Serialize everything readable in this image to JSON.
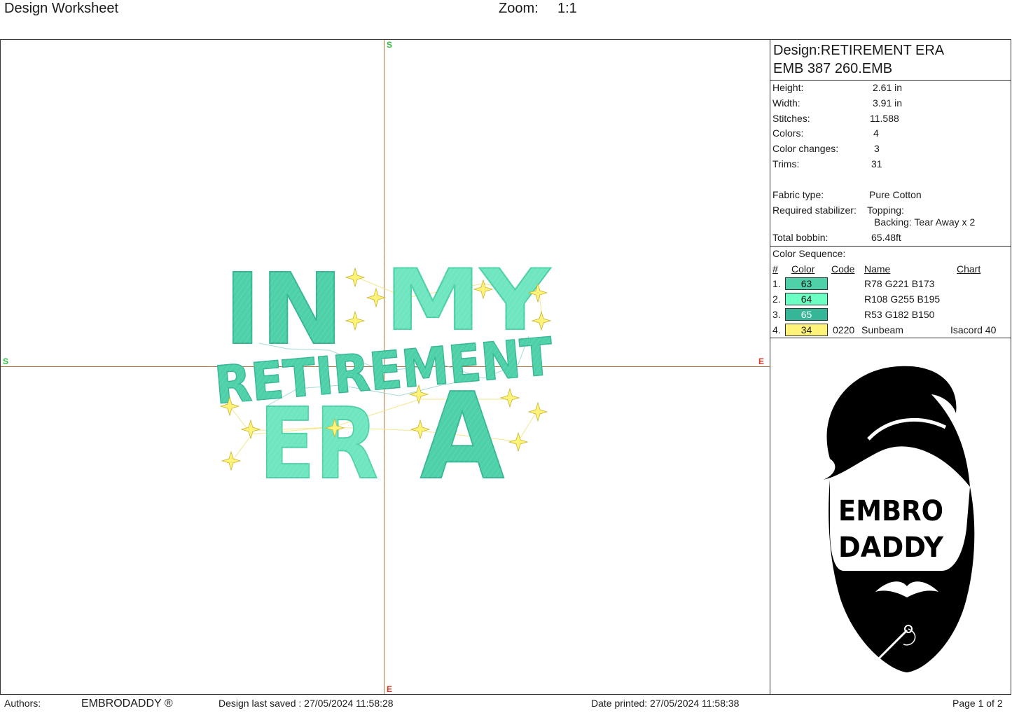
{
  "header": {
    "title": "Design Worksheet",
    "zoom_label": "Zoom:",
    "zoom_value": "1:1"
  },
  "canvas": {
    "markers": {
      "top": "S",
      "left": "S",
      "right": "E",
      "bottom": "E"
    },
    "design_text": {
      "line1": "IN MY",
      "line2": "RETIREMENT",
      "line3": "ERA"
    },
    "colors": {
      "teal_dark": "#4ad2a8",
      "teal_light": "#6fe6c0",
      "teal_mid": "#35b696",
      "star": "#fff37a",
      "guide": "#b5733c"
    }
  },
  "info": {
    "design_name": "Design:RETIREMENT ERA",
    "file_name": "EMB 387 260.EMB",
    "properties": [
      {
        "label": "Height:",
        "value": "2.61 in"
      },
      {
        "label": "Width:",
        "value": "3.91 in"
      },
      {
        "label": "Stitches:",
        "value": "11.588"
      },
      {
        "label": "Colors:",
        "value": "4"
      },
      {
        "label": "Color changes:",
        "value": "3"
      },
      {
        "label": "Trims:",
        "value": "31"
      }
    ],
    "fabric": {
      "label": "Fabric type:",
      "value": "Pure Cotton"
    },
    "stabilizer": {
      "label": "Required stabilizer:",
      "topping": "Topping:",
      "backing": "Backing: Tear Away x 2"
    },
    "bobbin": {
      "label": "Total bobbin:",
      "value": "65.48ft"
    },
    "sequence": {
      "title": "Color Sequence:",
      "headers": {
        "num": "#",
        "color": "Color",
        "code": "Code",
        "name": "Name",
        "chart": "Chart"
      },
      "rows": [
        {
          "num": "1.",
          "swatch": "63",
          "hex": "#4ed1a8",
          "code": "",
          "name": "R78 G221 B173",
          "chart": ""
        },
        {
          "num": "2.",
          "swatch": "64",
          "hex": "#6cffc3",
          "code": "",
          "name": "R108 G255 B195",
          "chart": ""
        },
        {
          "num": "3.",
          "swatch": "65",
          "hex": "#35b696",
          "code": "",
          "name": "R53 G182 B150",
          "chart": ""
        },
        {
          "num": "4.",
          "swatch": "34",
          "hex": "#fff37a",
          "code": "0220",
          "name": "Sunbeam",
          "chart": "Isacord 40"
        }
      ]
    },
    "logo": {
      "line1": "EMBRO",
      "line2": "DADDY"
    }
  },
  "footer": {
    "authors_label": "Authors:",
    "authors_value": "EMBRODADDY ®",
    "saved": "Design last saved : 27/05/2024 11:58:28",
    "printed": "Date printed: 27/05/2024 11:58:38",
    "page": "Page 1 of 2"
  }
}
